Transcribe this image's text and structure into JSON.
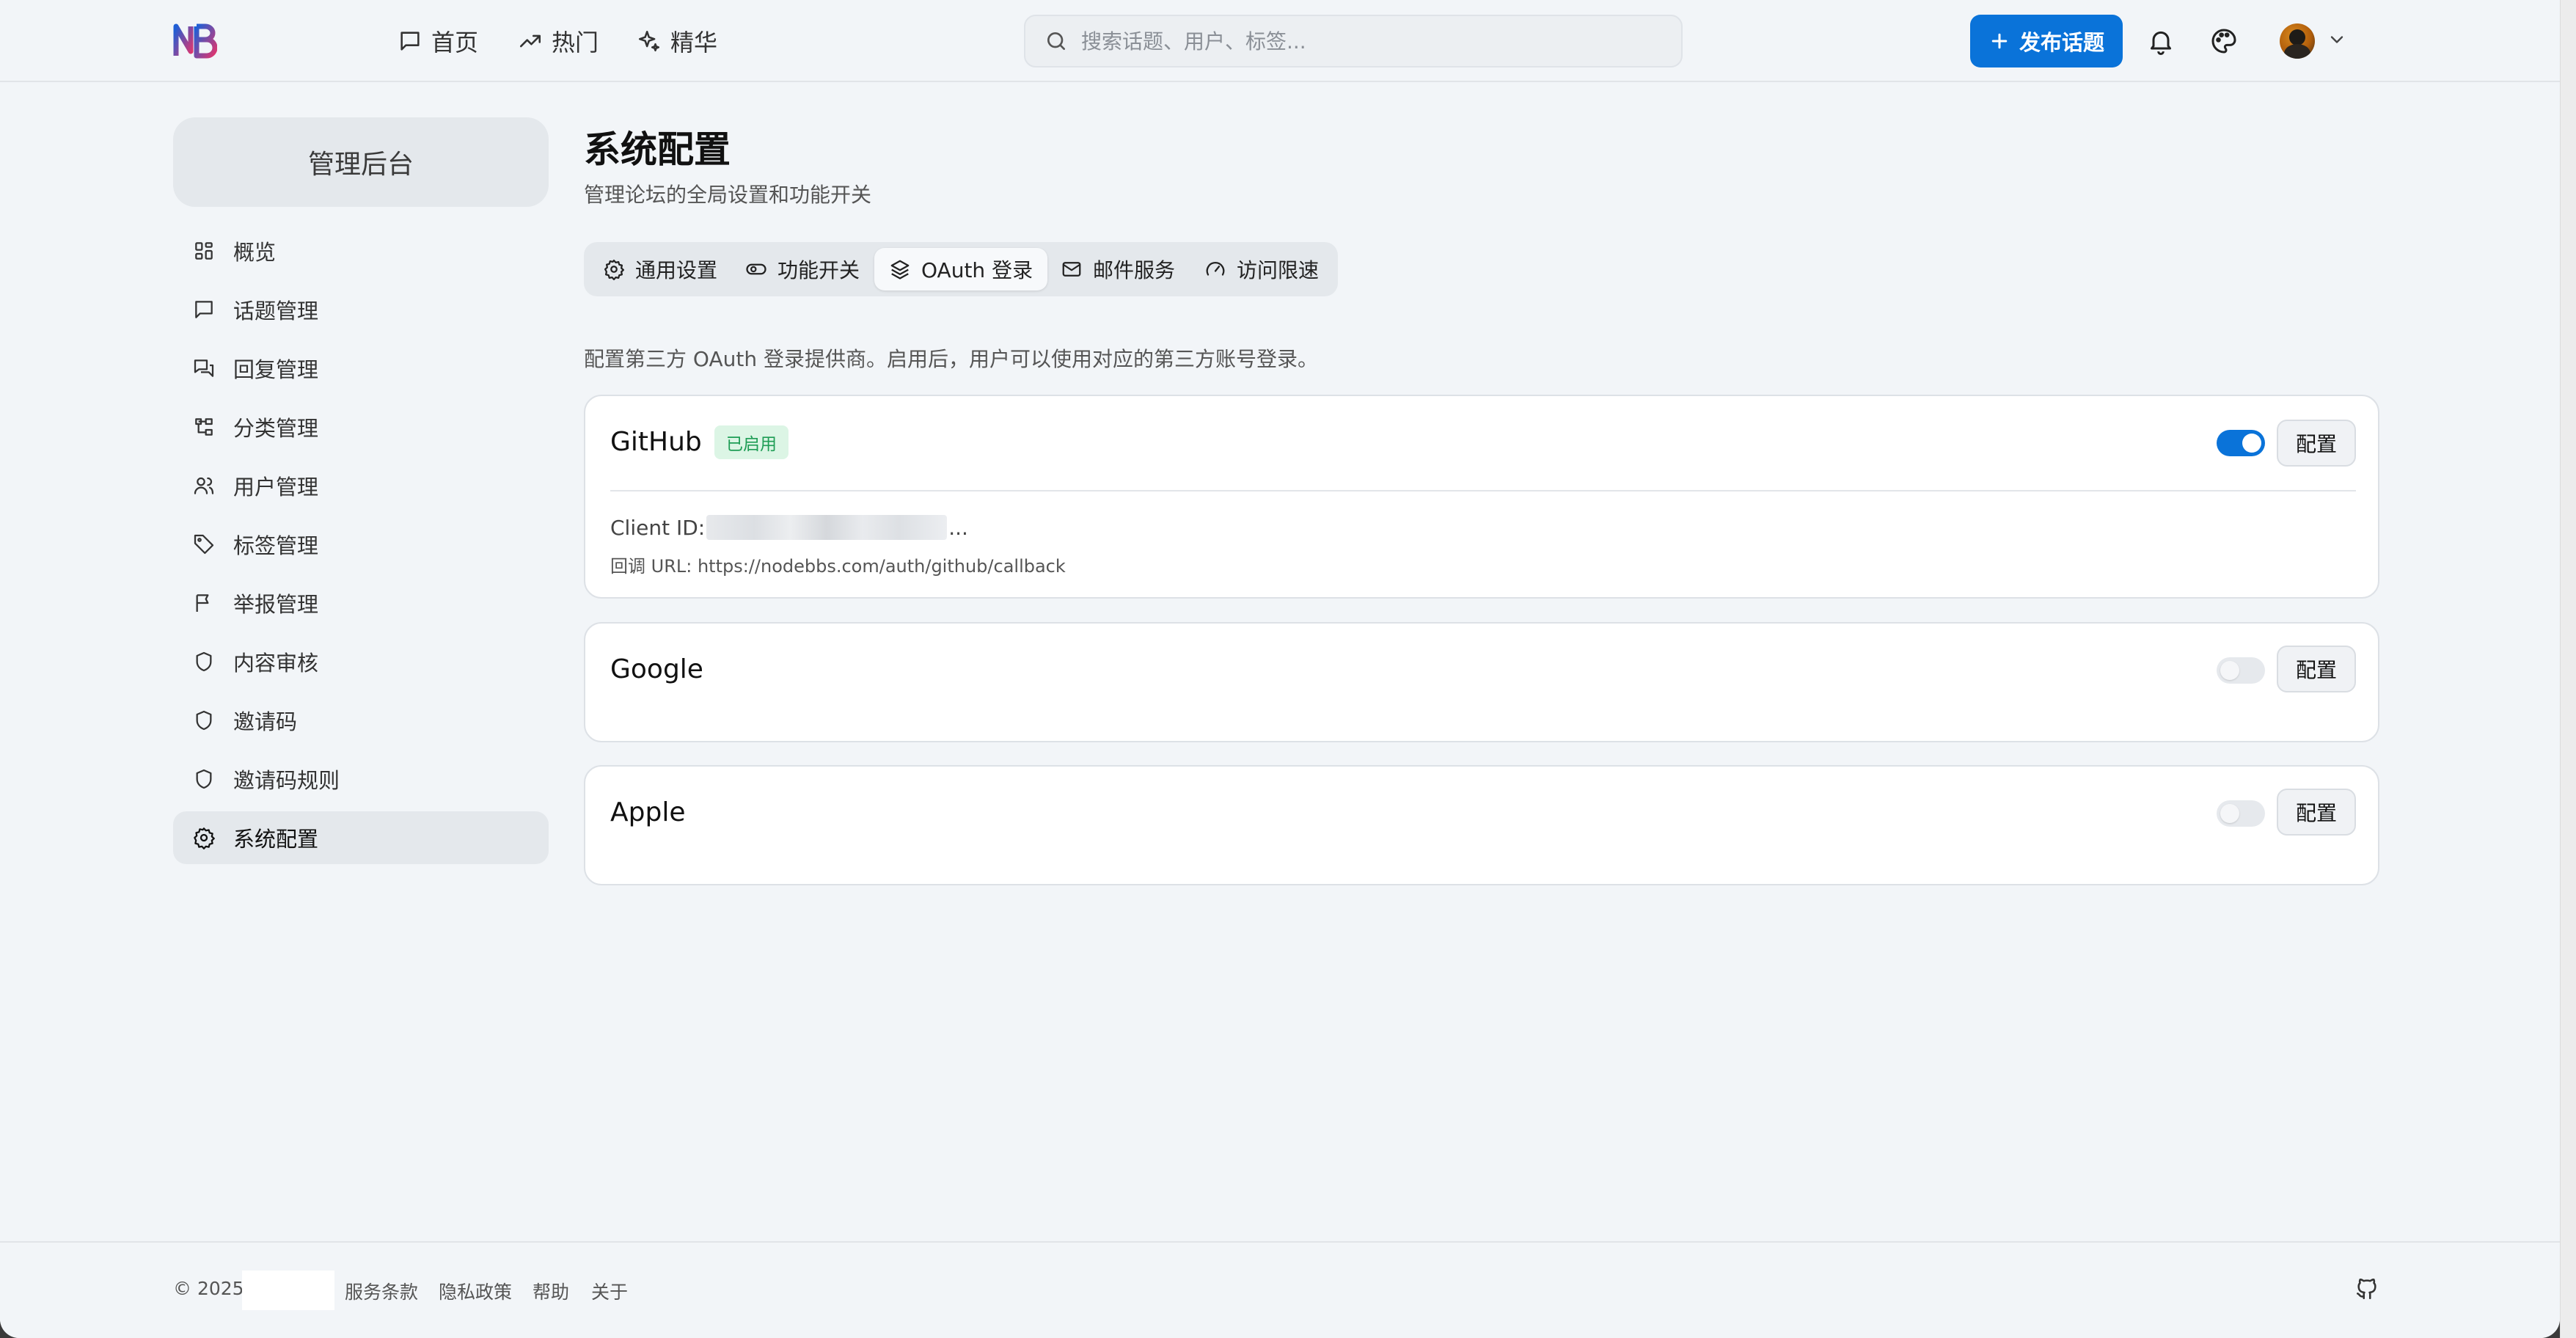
{
  "header": {
    "logo_text": "NB",
    "nav": [
      {
        "label": "首页",
        "icon": "message-square-icon"
      },
      {
        "label": "热门",
        "icon": "trending-up-icon"
      },
      {
        "label": "精华",
        "icon": "sparkles-icon"
      }
    ],
    "search_placeholder": "搜索话题、用户、标签...",
    "publish_label": "发布话题"
  },
  "sidebar": {
    "title": "管理后台",
    "items": [
      {
        "label": "概览",
        "icon": "dashboard-grid-icon"
      },
      {
        "label": "话题管理",
        "icon": "message-square-icon"
      },
      {
        "label": "回复管理",
        "icon": "messages-icon"
      },
      {
        "label": "分类管理",
        "icon": "folder-tree-icon"
      },
      {
        "label": "用户管理",
        "icon": "users-icon"
      },
      {
        "label": "标签管理",
        "icon": "tag-icon"
      },
      {
        "label": "举报管理",
        "icon": "flag-icon"
      },
      {
        "label": "内容审核",
        "icon": "shield-icon"
      },
      {
        "label": "邀请码",
        "icon": "shield-icon"
      },
      {
        "label": "邀请码规则",
        "icon": "shield-icon"
      },
      {
        "label": "系统配置",
        "icon": "gear-icon",
        "active": true
      }
    ]
  },
  "main": {
    "title": "系统配置",
    "subtitle": "管理论坛的全局设置和功能开关",
    "tabs": [
      {
        "label": "通用设置",
        "icon": "gear-icon"
      },
      {
        "label": "功能开关",
        "icon": "toggle-icon"
      },
      {
        "label": "OAuth 登录",
        "icon": "layers-icon",
        "active": true
      },
      {
        "label": "邮件服务",
        "icon": "mail-icon"
      },
      {
        "label": "访问限速",
        "icon": "gauge-icon"
      }
    ],
    "intro": "配置第三方 OAuth 登录提供商。启用后，用户可以使用对应的第三方账号登录。",
    "providers": [
      {
        "name": "GitHub",
        "badge": "已启用",
        "enabled": true,
        "config_label": "配置",
        "client_id_label": "Client ID:",
        "client_id_suffix": "...",
        "callback": "回调 URL: https://nodebbs.com/auth/github/callback"
      },
      {
        "name": "Google",
        "enabled": false,
        "config_label": "配置"
      },
      {
        "name": "Apple",
        "enabled": false,
        "config_label": "配置"
      }
    ]
  },
  "footer": {
    "copyright": "© 2025",
    "links": [
      "服务条款",
      "隐私政策",
      "帮助",
      "关于"
    ]
  },
  "colors": {
    "accent": "#0a73d9",
    "enabled_badge_bg": "#dcf5e5",
    "enabled_badge_text": "#1e9d55",
    "background": "#f2f5f8"
  }
}
